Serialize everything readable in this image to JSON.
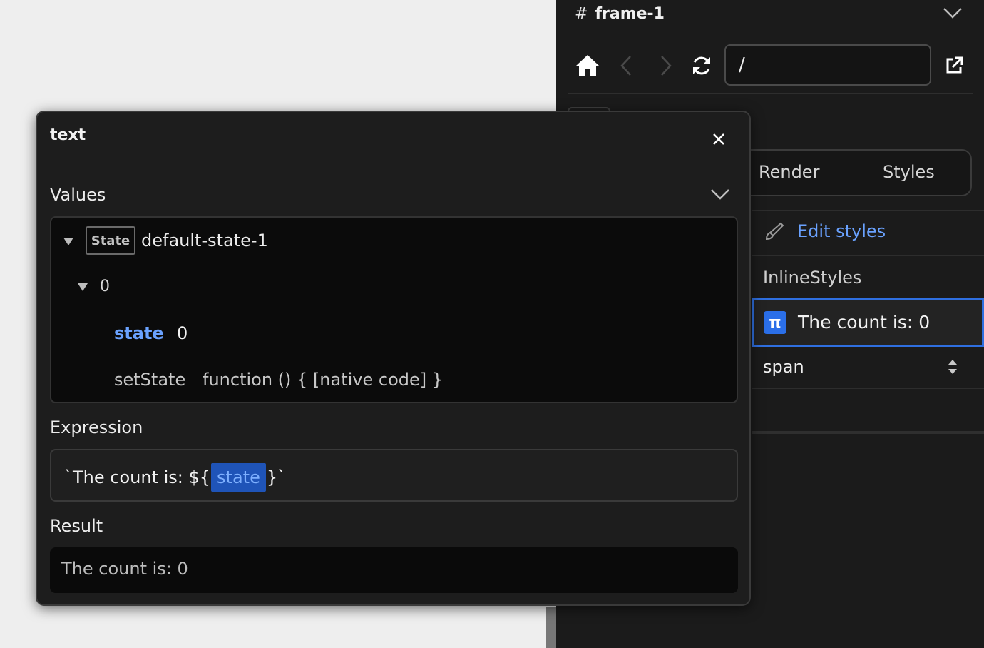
{
  "frame": {
    "hash_symbol": "#",
    "title": "frame-1"
  },
  "nav": {
    "url_value": "/"
  },
  "tabs": {
    "render": "Render",
    "styles": "Styles"
  },
  "styles_panel": {
    "edit_styles": "Edit styles",
    "inline_styles": "InlineStyles",
    "selected_badge": "π",
    "selected_text": "The count is: 0",
    "element_tag": "span"
  },
  "popover": {
    "title": "text",
    "values_label": "Values",
    "state_badge": "State",
    "state_name": "default-state-1",
    "index": "0",
    "entries": [
      {
        "key": "state",
        "value": "0"
      },
      {
        "key": "setState",
        "value": "function () { [native code] }"
      }
    ],
    "expression_label": "Expression",
    "expression": {
      "prefix": "`The count is: ${",
      "token": "state",
      "suffix": "}`"
    },
    "result_label": "Result",
    "result": "The count is: 0"
  },
  "colors": {
    "accent_blue": "#6aa2ff",
    "selection_border": "#2f6fe0",
    "panel_bg": "#1b1b1b",
    "popover_bg": "#1d1d1d"
  },
  "icons": [
    "hash-icon",
    "chevron-down-icon",
    "home-icon",
    "back-arrow-icon",
    "forward-arrow-icon",
    "refresh-icon",
    "external-link-icon",
    "brush-icon",
    "pi-icon",
    "up-down-icon",
    "close-icon",
    "triangle-down-icon"
  ]
}
